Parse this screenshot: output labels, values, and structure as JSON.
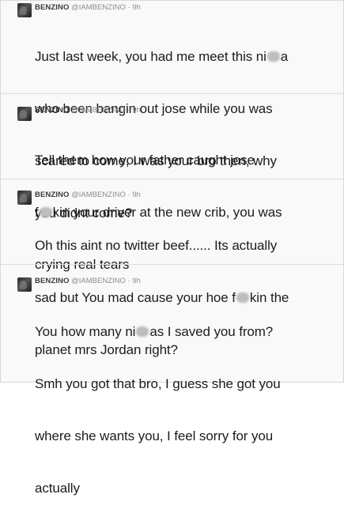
{
  "tweets": [
    {
      "name": "BENZINO",
      "handle": "@IAMBENZINO",
      "sep": "·",
      "time": "9h",
      "lines": [
        {
          "a": "Just last week, you had me meet this ni",
          "censored": true,
          "b": "a"
        },
        {
          "a": "who been bangin out jose while you was",
          "censored": false,
          "b": ""
        },
        {
          "a": "scared to come, I was your bro then, why",
          "censored": false,
          "b": ""
        },
        {
          "a": "you didnt come?",
          "censored": false,
          "b": ""
        }
      ]
    },
    {
      "name": "BENZINO",
      "handle": "@IAMBENZINO",
      "sep": "·",
      "time": "9h",
      "lines": [
        {
          "a": "Tell them how your father caught jose",
          "censored": false,
          "b": ""
        },
        {
          "a": "f",
          "censored": true,
          "b": "kin your driver at the new crib, you was"
        },
        {
          "a": "crying real tears",
          "censored": false,
          "b": ""
        }
      ]
    },
    {
      "name": "BENZINO",
      "handle": "@IAMBENZINO",
      "sep": "·",
      "time": "9h",
      "lines": [
        {
          "a": "Oh this aint no twitter beef...... Its actually",
          "censored": false,
          "b": ""
        },
        {
          "a": "sad but You mad cause your hoe f",
          "censored": true,
          "b": "kin the"
        },
        {
          "a": "planet mrs Jordan right?",
          "censored": false,
          "b": ""
        }
      ]
    },
    {
      "name": "BENZINO",
      "handle": "@IAMBENZINO",
      "sep": "·",
      "time": "9h",
      "lines": [
        {
          "a": "You how many ni",
          "censored": true,
          "b": "as I saved you from?"
        },
        {
          "a": "Smh you got that bro, I guess she got you",
          "censored": false,
          "b": ""
        },
        {
          "a": "where she wants you, I feel sorry for you",
          "censored": false,
          "b": ""
        },
        {
          "a": "actually",
          "censored": false,
          "b": ""
        }
      ]
    }
  ]
}
